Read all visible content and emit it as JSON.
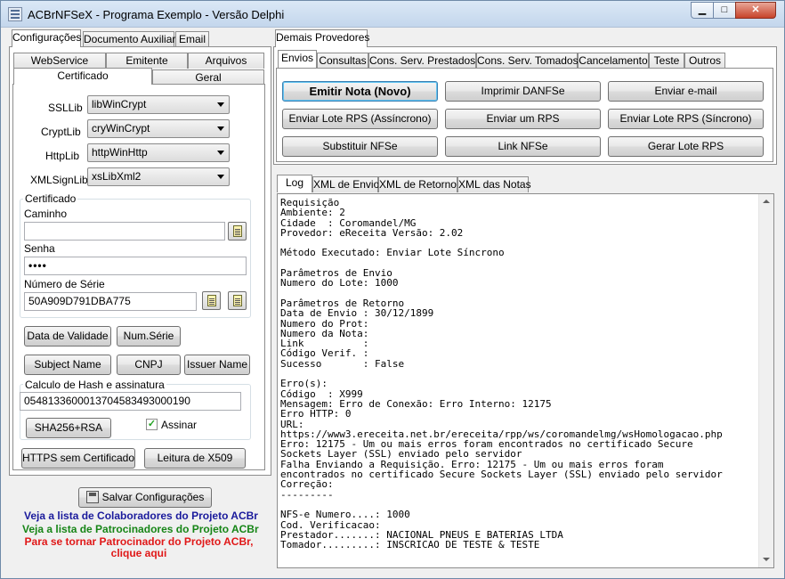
{
  "window": {
    "title": "ACBrNFSeX - Programa Exemplo - Versão Delphi",
    "minimize": "▁",
    "maximize": "□",
    "close": "✕"
  },
  "left": {
    "tabs": [
      "Configurações",
      "Documento Auxiliar",
      "Email"
    ],
    "subtabs_row1": [
      "WebService",
      "Emitente",
      "Arquivos"
    ],
    "subtabs_row2": [
      "Certificado",
      "Geral"
    ],
    "ssl": [
      {
        "label": "SSLLib",
        "value": "libWinCrypt"
      },
      {
        "label": "CryptLib",
        "value": "cryWinCrypt"
      },
      {
        "label": "HttpLib",
        "value": "httpWinHttp"
      },
      {
        "label": "XMLSignLib",
        "value": "xsLibXml2"
      }
    ],
    "cert": {
      "group_title": "Certificado",
      "path_label": "Caminho",
      "path_value": "",
      "password_label": "Senha",
      "password_value": "••••",
      "serial_label": "Número de Série",
      "serial_value": "50A909D791DBA775"
    },
    "buttons": {
      "validity": "Data de Validade",
      "num_serie": "Num.Série",
      "subject": "Subject Name",
      "cnpj": "CNPJ",
      "issuer": "Issuer Name",
      "sha": "SHA256+RSA",
      "https": "HTTPS sem Certificado",
      "x509": "Leitura de X509",
      "save": "Salvar Configurações"
    },
    "hash": {
      "group_title": "Calculo de Hash e assinatura",
      "value": "05481336000137045834930001​90",
      "sign_label": "Assinar",
      "sign_checked": "✓"
    },
    "links": {
      "collaborators": "Veja a lista de Colaboradores do Projeto ACBr",
      "sponsors": "Veja a lista de Patrocinadores do Projeto ACBr",
      "become_line1": "Para se tornar Patrocinador do Projeto ACBr,",
      "become_line2": "clique aqui"
    }
  },
  "right": {
    "top_tab": "Demais Provedores",
    "tabs": [
      "Envios",
      "Consultas",
      "Cons. Serv. Prestados",
      "Cons. Serv. Tomados",
      "Cancelamento",
      "Teste",
      "Outros"
    ],
    "actions": [
      "Emitir Nota (Novo)",
      "Imprimir DANFSe",
      "Enviar e-mail",
      "Enviar Lote RPS (Assíncrono)",
      "Enviar um RPS",
      "Enviar Lote RPS (Síncrono)",
      "Substituir NFSe",
      "Link NFSe",
      "Gerar Lote RPS"
    ],
    "log_tabs": [
      "Log",
      "XML de Envio",
      "XML de Retorno",
      "XML das Notas"
    ],
    "log_text": "Requisição\nAmbiente: 2\nCidade  : Coromandel/MG\nProvedor: eReceita Versão: 2.02\n\nMétodo Executado: Enviar Lote Síncrono\n\nParâmetros de Envio\nNumero do Lote: 1000\n\nParâmetros de Retorno\nData de Envio : 30/12/1899\nNumero do Prot:\nNumero da Nota:\nLink          :\nCódigo Verif. :\nSucesso       : False\n\nErro(s):\nCódigo  : X999\nMensagem: Erro de Conexão: Erro Interno: 12175\nErro HTTP: 0\nURL:\nhttps://www3.ereceita.net.br/ereceita/rpp/ws/coromandelmg/wsHomologacao.php\nErro: 12175 - Um ou mais erros foram encontrados no certificado Secure\nSockets Layer (SSL) enviado pelo servidor\nFalha Enviando a Requisição. Erro: 12175 - Um ou mais erros foram\nencontrados no certificado Secure Sockets Layer (SSL) enviado pelo servidor\nCorreção:\n---------\n\nNFS-e Numero....: 1000\nCod. Verificacao:\nPrestador.......: NACIONAL PNEUS E BATERIAS LTDA\nTomador.........: INSCRICAO DE TESTE & TESTE"
  }
}
